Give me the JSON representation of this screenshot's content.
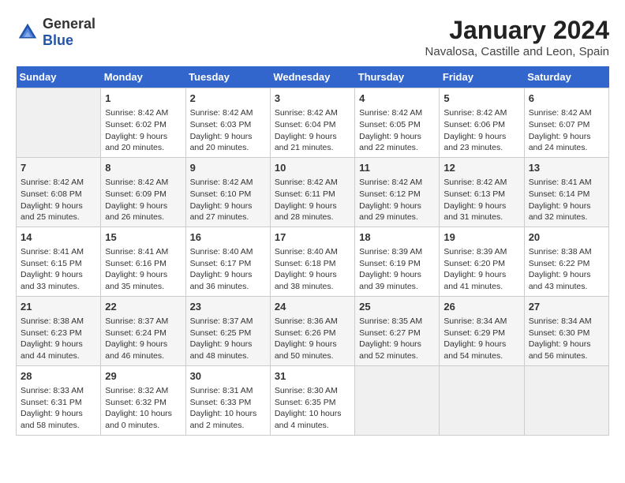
{
  "header": {
    "logo_general": "General",
    "logo_blue": "Blue",
    "title": "January 2024",
    "subtitle": "Navalosa, Castille and Leon, Spain"
  },
  "days_of_week": [
    "Sunday",
    "Monday",
    "Tuesday",
    "Wednesday",
    "Thursday",
    "Friday",
    "Saturday"
  ],
  "weeks": [
    [
      {
        "day": "",
        "empty": true
      },
      {
        "day": "1",
        "sunrise": "Sunrise: 8:42 AM",
        "sunset": "Sunset: 6:02 PM",
        "daylight": "Daylight: 9 hours and 20 minutes."
      },
      {
        "day": "2",
        "sunrise": "Sunrise: 8:42 AM",
        "sunset": "Sunset: 6:03 PM",
        "daylight": "Daylight: 9 hours and 20 minutes."
      },
      {
        "day": "3",
        "sunrise": "Sunrise: 8:42 AM",
        "sunset": "Sunset: 6:04 PM",
        "daylight": "Daylight: 9 hours and 21 minutes."
      },
      {
        "day": "4",
        "sunrise": "Sunrise: 8:42 AM",
        "sunset": "Sunset: 6:05 PM",
        "daylight": "Daylight: 9 hours and 22 minutes."
      },
      {
        "day": "5",
        "sunrise": "Sunrise: 8:42 AM",
        "sunset": "Sunset: 6:06 PM",
        "daylight": "Daylight: 9 hours and 23 minutes."
      },
      {
        "day": "6",
        "sunrise": "Sunrise: 8:42 AM",
        "sunset": "Sunset: 6:07 PM",
        "daylight": "Daylight: 9 hours and 24 minutes."
      }
    ],
    [
      {
        "day": "7",
        "sunrise": "Sunrise: 8:42 AM",
        "sunset": "Sunset: 6:08 PM",
        "daylight": "Daylight: 9 hours and 25 minutes."
      },
      {
        "day": "8",
        "sunrise": "Sunrise: 8:42 AM",
        "sunset": "Sunset: 6:09 PM",
        "daylight": "Daylight: 9 hours and 26 minutes."
      },
      {
        "day": "9",
        "sunrise": "Sunrise: 8:42 AM",
        "sunset": "Sunset: 6:10 PM",
        "daylight": "Daylight: 9 hours and 27 minutes."
      },
      {
        "day": "10",
        "sunrise": "Sunrise: 8:42 AM",
        "sunset": "Sunset: 6:11 PM",
        "daylight": "Daylight: 9 hours and 28 minutes."
      },
      {
        "day": "11",
        "sunrise": "Sunrise: 8:42 AM",
        "sunset": "Sunset: 6:12 PM",
        "daylight": "Daylight: 9 hours and 29 minutes."
      },
      {
        "day": "12",
        "sunrise": "Sunrise: 8:42 AM",
        "sunset": "Sunset: 6:13 PM",
        "daylight": "Daylight: 9 hours and 31 minutes."
      },
      {
        "day": "13",
        "sunrise": "Sunrise: 8:41 AM",
        "sunset": "Sunset: 6:14 PM",
        "daylight": "Daylight: 9 hours and 32 minutes."
      }
    ],
    [
      {
        "day": "14",
        "sunrise": "Sunrise: 8:41 AM",
        "sunset": "Sunset: 6:15 PM",
        "daylight": "Daylight: 9 hours and 33 minutes."
      },
      {
        "day": "15",
        "sunrise": "Sunrise: 8:41 AM",
        "sunset": "Sunset: 6:16 PM",
        "daylight": "Daylight: 9 hours and 35 minutes."
      },
      {
        "day": "16",
        "sunrise": "Sunrise: 8:40 AM",
        "sunset": "Sunset: 6:17 PM",
        "daylight": "Daylight: 9 hours and 36 minutes."
      },
      {
        "day": "17",
        "sunrise": "Sunrise: 8:40 AM",
        "sunset": "Sunset: 6:18 PM",
        "daylight": "Daylight: 9 hours and 38 minutes."
      },
      {
        "day": "18",
        "sunrise": "Sunrise: 8:39 AM",
        "sunset": "Sunset: 6:19 PM",
        "daylight": "Daylight: 9 hours and 39 minutes."
      },
      {
        "day": "19",
        "sunrise": "Sunrise: 8:39 AM",
        "sunset": "Sunset: 6:20 PM",
        "daylight": "Daylight: 9 hours and 41 minutes."
      },
      {
        "day": "20",
        "sunrise": "Sunrise: 8:38 AM",
        "sunset": "Sunset: 6:22 PM",
        "daylight": "Daylight: 9 hours and 43 minutes."
      }
    ],
    [
      {
        "day": "21",
        "sunrise": "Sunrise: 8:38 AM",
        "sunset": "Sunset: 6:23 PM",
        "daylight": "Daylight: 9 hours and 44 minutes."
      },
      {
        "day": "22",
        "sunrise": "Sunrise: 8:37 AM",
        "sunset": "Sunset: 6:24 PM",
        "daylight": "Daylight: 9 hours and 46 minutes."
      },
      {
        "day": "23",
        "sunrise": "Sunrise: 8:37 AM",
        "sunset": "Sunset: 6:25 PM",
        "daylight": "Daylight: 9 hours and 48 minutes."
      },
      {
        "day": "24",
        "sunrise": "Sunrise: 8:36 AM",
        "sunset": "Sunset: 6:26 PM",
        "daylight": "Daylight: 9 hours and 50 minutes."
      },
      {
        "day": "25",
        "sunrise": "Sunrise: 8:35 AM",
        "sunset": "Sunset: 6:27 PM",
        "daylight": "Daylight: 9 hours and 52 minutes."
      },
      {
        "day": "26",
        "sunrise": "Sunrise: 8:34 AM",
        "sunset": "Sunset: 6:29 PM",
        "daylight": "Daylight: 9 hours and 54 minutes."
      },
      {
        "day": "27",
        "sunrise": "Sunrise: 8:34 AM",
        "sunset": "Sunset: 6:30 PM",
        "daylight": "Daylight: 9 hours and 56 minutes."
      }
    ],
    [
      {
        "day": "28",
        "sunrise": "Sunrise: 8:33 AM",
        "sunset": "Sunset: 6:31 PM",
        "daylight": "Daylight: 9 hours and 58 minutes."
      },
      {
        "day": "29",
        "sunrise": "Sunrise: 8:32 AM",
        "sunset": "Sunset: 6:32 PM",
        "daylight": "Daylight: 10 hours and 0 minutes."
      },
      {
        "day": "30",
        "sunrise": "Sunrise: 8:31 AM",
        "sunset": "Sunset: 6:33 PM",
        "daylight": "Daylight: 10 hours and 2 minutes."
      },
      {
        "day": "31",
        "sunrise": "Sunrise: 8:30 AM",
        "sunset": "Sunset: 6:35 PM",
        "daylight": "Daylight: 10 hours and 4 minutes."
      },
      {
        "day": "",
        "empty": true
      },
      {
        "day": "",
        "empty": true
      },
      {
        "day": "",
        "empty": true
      }
    ]
  ]
}
